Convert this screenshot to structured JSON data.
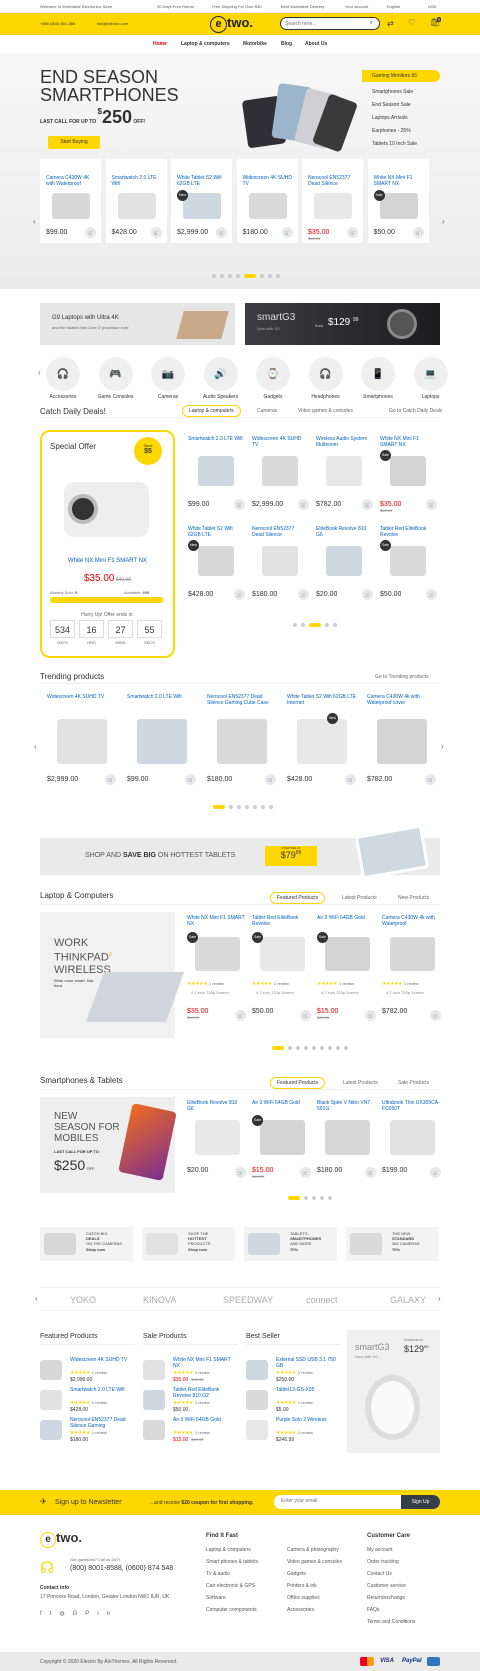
{
  "topbar": {
    "welcome": "Welcome to Worldwide Electronics Store",
    "phone": "+866 (800) 801-456",
    "email": "info@electro.com",
    "promo1": "30 Days Free Return",
    "promo2": "Free Shipping For Over $30",
    "promo3": "Best Worldwide Delivery",
    "account": "Your account",
    "lang": "English",
    "currency": "USD"
  },
  "header": {
    "logo": "two.",
    "logo_letter": "e",
    "search_placeholder": "Search here...",
    "cart_count": "0"
  },
  "nav": [
    "Home",
    "Laptop & computers",
    "Motorbike",
    "Blog",
    "About Us"
  ],
  "hero": {
    "title1": "END SEASON",
    "title2": "SMARTPHONES",
    "subtitle": "LAST CALL FOR UP TO",
    "price": "250",
    "price_prefix": "$",
    "price_suffix": "OFF!",
    "cta": "Start Buying",
    "menu_head": "Gaming Monitors 65",
    "menu": [
      "Smartphones Sale",
      "End Season Sale",
      "Laptops Arrivals",
      "Earphones - 25%",
      "Tablets 10 Inch Sale"
    ]
  },
  "hero_products": [
    {
      "name": "Camera C430W 4K with Waterproof",
      "price": "$99.00",
      "old": ""
    },
    {
      "name": "Smartwatch 2.0 LTE Wifi",
      "price": "$428.00",
      "old": ""
    },
    {
      "name": "White Tablet S2 Wifi 62GB LTE",
      "price": "$2,999.00",
      "old": "",
      "badge": "New"
    },
    {
      "name": "Widescreen 4K SUHD TV",
      "price": "$180.00",
      "old": ""
    },
    {
      "name": "Nerocool EN52377 Dead Silence",
      "price": "$35.00",
      "old": "$40.00"
    },
    {
      "name": "White NX Mini F1 SMART NX",
      "price": "$50.00",
      "old": "",
      "badge": "Sale"
    }
  ],
  "banners": {
    "b1_line1": "G9 Laptops with Ultra 4K",
    "b1_line2": "and the fastest Intel Core i7 processor ever",
    "b2_title": "smartG3",
    "b2_sub": "Now with 4G",
    "b2_from": "from",
    "b2_price": "$129",
    "b2_cents": "99"
  },
  "categories": [
    "Accessories",
    "Game Consoles",
    "Cameras",
    "Audio Speakers",
    "Gadgets",
    "Headphones",
    "Smartphones",
    "Laptops"
  ],
  "deals": {
    "title": "Catch Daily Deals!",
    "tabs": [
      "Laptop & computers",
      "Cameras",
      "Video games & consoles",
      "Go to Catch Daily Deals"
    ],
    "special": "Special Offer",
    "save_label": "Save",
    "save_amount": "$5",
    "special_name": "White NX Mini F1 SMART NX",
    "special_price": "$35.00",
    "special_old": "$40.00",
    "sold_label": "Already Sold:",
    "sold": "5",
    "avail_label": "Available:",
    "avail": "495",
    "hurry": "Hurry Up! Offer ends in:",
    "timer": [
      {
        "v": "534",
        "l": "DAYS"
      },
      {
        "v": "16",
        "l": "HRS"
      },
      {
        "v": "27",
        "l": "MINS"
      },
      {
        "v": "55",
        "l": "SECS"
      }
    ],
    "items": [
      {
        "name": "Smartwatch 2.0 LTE Wifi",
        "price": "$99.00",
        "old": ""
      },
      {
        "name": "Widescreen 4K SUHD TV",
        "price": "$2,999.00",
        "old": ""
      },
      {
        "name": "Wireless Audio System Multiroom",
        "price": "$782.00",
        "old": ""
      },
      {
        "name": "White NX Mini F1 SMART NX",
        "price": "$35.00",
        "old": "$40.00",
        "badge": "Sale"
      },
      {
        "name": "White Tablet S2 Wifi 62GB LTE",
        "price": "$428.00",
        "old": "",
        "badge": "New"
      },
      {
        "name": "Nerocool EN52377 Dead Silence",
        "price": "$180.00",
        "old": ""
      },
      {
        "name": "EliteBook Revolve 810 G6",
        "price": "$20.00",
        "old": ""
      },
      {
        "name": "Tablet Red EliteBook Revolve",
        "price": "$50.00",
        "old": "",
        "badge": "Sale"
      }
    ]
  },
  "trending": {
    "title": "Trending products",
    "link": "Go to Trending products",
    "items": [
      {
        "name": "Widescreen 4K SUHD TV",
        "price": "$2,999.00"
      },
      {
        "name": "Smartwatch 2.0 LTE Wifi",
        "price": "$99.00"
      },
      {
        "name": "Nerocool EN52377 Dead Silence Gaming Cube Case",
        "price": "$180.00"
      },
      {
        "name": "White Tablet S2 Wifi 62GB LTE Internet",
        "price": "$428.00",
        "badge": "New"
      },
      {
        "name": "Camera C430W 4k with Waterproof cover",
        "price": "$782.00"
      }
    ]
  },
  "tablet_banner": {
    "text1": "SHOP AND",
    "text2": "SAVE BIG",
    "text3": "ON HOTTEST TABLETS",
    "from": "STARTING AT",
    "price": "$79",
    "cents": "99"
  },
  "laptops": {
    "title": "Laptop & Computers",
    "tabs": [
      "Featured Products",
      "Latest Products",
      "New Products"
    ],
    "promo1": "WORK",
    "promo2": "THINKPAD",
    "promo3": "WIRELESS",
    "promo_sup": "3",
    "promo_sub": "Work more smart. Not hard.",
    "items": [
      {
        "name": "White NX Mini F1 SMART NX",
        "price": "$35.00",
        "old": "$40.00",
        "badge": "Sale",
        "spec": "4.7 inch 720p Screen"
      },
      {
        "name": "Tablet Red EliteBook Revolve",
        "price": "$50.00",
        "old": "",
        "badge": "Sale",
        "spec": "4.7 inch 720p Screen"
      },
      {
        "name": "Air 3 WiFi 64GB Gold",
        "price": "$15.00",
        "old": "$25.00",
        "badge": "Sale",
        "spec": "4.7 inch 720p Screen"
      },
      {
        "name": "Camera C430W 4k with Waterproof",
        "price": "$782.00",
        "old": "",
        "spec": "4.7 inch 720p Screen"
      }
    ],
    "review": "1 review"
  },
  "phones": {
    "title": "Smartphones & Tablets",
    "tabs": [
      "Featured Products",
      "Latest Products",
      "Sale Products"
    ],
    "promo1": "NEW",
    "promo2": "SEASON FOR",
    "promo3": "MOBILES",
    "promo_sub": "LAST CALL FOR UP TO",
    "promo_price": "$250",
    "promo_off": "OFF",
    "items": [
      {
        "name": "EliteBook Revolve 810 G6",
        "price": "$20.00",
        "old": ""
      },
      {
        "name": "Air 3 WiFi 64GB Gold",
        "price": "$15.00",
        "old": "$25.00",
        "badge": "Sale"
      },
      {
        "name": "Black Spire V Nitro VN7-591G",
        "price": "$180.00",
        "old": ""
      },
      {
        "name": "Ultrabook Thin UX305CA-FC050T",
        "price": "$199.00",
        "old": ""
      }
    ]
  },
  "mini_banners": [
    {
      "t1": "CATCH BIG",
      "t2": "DEALS",
      "t3": "ON THE CAMERAS",
      "cta": "Shop now"
    },
    {
      "t1": "SHOP THE",
      "t2": "HOTTEST",
      "t3": "PRODUCTS",
      "cta": "Shop now"
    },
    {
      "t1": "TABLETS,",
      "t2": "SMARTPHONES",
      "t3": "AND MORE",
      "cta": "70%"
    },
    {
      "t1": "THE NEW",
      "t2": "STANDARD",
      "t3": "360 CAMERAS",
      "cta": "70%"
    }
  ],
  "brands": [
    "YOKO",
    "KINOVA",
    "SPEEDWAY",
    "connect",
    "GALAXY"
  ],
  "lists": {
    "featured": {
      "title": "Featured Products",
      "items": [
        {
          "name": "Widescreen 4K SUHD TV",
          "price": "$2,999.00"
        },
        {
          "name": "Smartwatch 2.0 LTE Wifi",
          "price": "$428.00"
        },
        {
          "name": "Nerocool EN52377 Dead Silence Gaming",
          "price": "$180.00"
        }
      ]
    },
    "sale": {
      "title": "Sale Products",
      "items": [
        {
          "name": "White NX Mini F1 SMART NX",
          "price": "$35.00",
          "old": "$40.00"
        },
        {
          "name": "Tablet Red EliteBook Revolve 810 G2",
          "price": "$50.00"
        },
        {
          "name": "Air 3 WiFi 64GB Gold",
          "price": "$15.00",
          "old": "$25.00"
        }
      ]
    },
    "best": {
      "title": "Best Seller",
      "items": [
        {
          "name": "External SSD USB 3.1 750 GB",
          "price": "$250.00"
        },
        {
          "name": "Tablet13-GS-X05",
          "price": "$5.00"
        },
        {
          "name": "Purple Solo 2 Wireless",
          "price": "$246.99"
        }
      ]
    },
    "review": "1 review",
    "side_title": "smartG3",
    "side_sub": "Now with 4G",
    "side_price": "$129",
    "side_cents": "99",
    "side_from": "STARTING AT"
  },
  "newsletter": {
    "title": "Sign up to Newsletter",
    "text1": "...and receive",
    "text2": "$20 coupon for first shopping.",
    "placeholder": "Enter your email",
    "button": "Sign Up"
  },
  "footer": {
    "question": "Got questions? Call us 24/7!",
    "phones": "(800) 8001-8588, (0600) 874 548",
    "contact_title": "Contact info",
    "address": "17 Princess Road, London, Greater London NW1 8JR, UK",
    "find": "Find It Fast",
    "col1": [
      "Laptop & computers",
      "Smart phones & tablets",
      "Tv & audio",
      "Cart electronic & GPS",
      "Software",
      "Computer components"
    ],
    "col2": [
      "Camera & photography",
      "Video games & consoles",
      "Gadgets",
      "Printers & ink",
      "Office supplies",
      "Accessories"
    ],
    "care": "Customer Care",
    "col3": [
      "My account",
      "Order tracking",
      "Contact Us",
      "Customer service",
      "Return/exchange",
      "FAQs",
      "Terms and Conditions"
    ],
    "copyright": "Copyright © 2020 Electro By AloThemes. All Rights Reserved.",
    "pay": [
      "VISA",
      "PayPal"
    ]
  },
  "colors": {
    "accent": "#fed700",
    "link": "#0062bd",
    "sale": "#e5000a"
  }
}
